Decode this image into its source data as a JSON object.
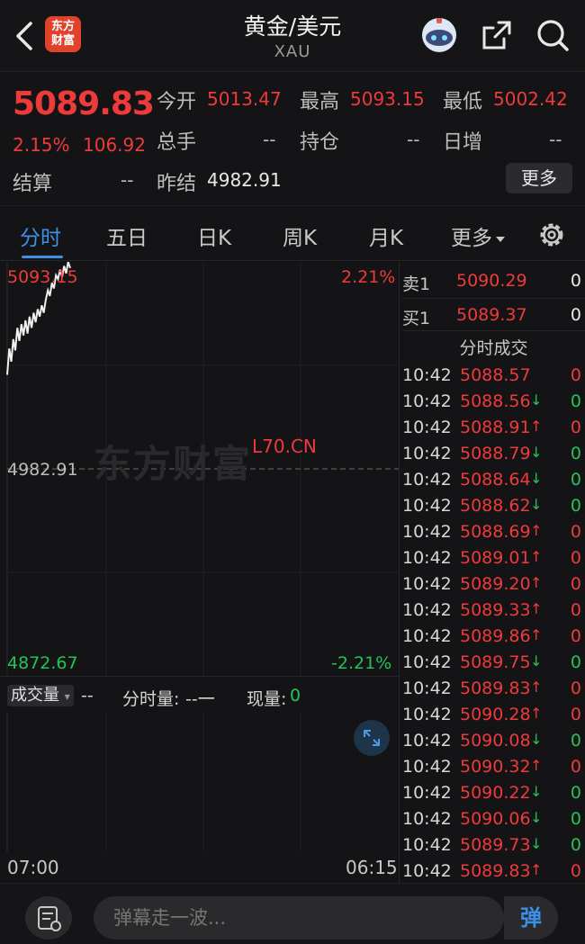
{
  "nav": {
    "logo_line1": "东方",
    "logo_line2": "财富",
    "title": "黄金/美元",
    "subtitle": "XAU"
  },
  "quote": {
    "last_price": "5089.83",
    "change_pct": "2.15%",
    "change_val": "106.92",
    "settle_label": "结算",
    "settle_val": "--",
    "open_label": "今开",
    "open_val": "5013.47",
    "high_label": "最高",
    "high_val": "5093.15",
    "low_label": "最低",
    "low_val": "5002.42",
    "volume_label": "总手",
    "volume_val": "--",
    "oi_label": "持仓",
    "oi_val": "--",
    "daily_inc_label": "日增",
    "daily_inc_val": "--",
    "prev_settle_label": "昨结",
    "prev_settle_val": "4982.91",
    "more_label": "更多"
  },
  "tabs": [
    {
      "label": "分时",
      "active": true
    },
    {
      "label": "五日",
      "active": false
    },
    {
      "label": "日K",
      "active": false
    },
    {
      "label": "周K",
      "active": false
    },
    {
      "label": "月K",
      "active": false
    },
    {
      "label": "更多",
      "active": false
    }
  ],
  "chart": {
    "top_price": "5093.15",
    "top_pct": "2.21%",
    "mid_price": "4982.91",
    "bottom_price": "4872.67",
    "bottom_pct": "-2.21%",
    "watermark": "东方财富",
    "overlay_text": "L70.CN",
    "time_start": "07:00",
    "time_end": "06:15"
  },
  "chart_data": {
    "type": "line",
    "y_range": [
      4872.67,
      5093.15
    ],
    "baseline": 4982.91,
    "series": [
      {
        "values": [
          5033,
          5047,
          5040,
          5052,
          5046,
          5058,
          5051,
          5060,
          5054,
          5062,
          5055,
          5064,
          5058,
          5066,
          5061,
          5068,
          5064,
          5070,
          5066,
          5073,
          5078,
          5075,
          5082,
          5079,
          5086,
          5084,
          5089,
          5085,
          5091,
          5087,
          5093.15,
          5089.83
        ]
      }
    ]
  },
  "volume": {
    "dropdown_label": "成交量",
    "vol_val": "--",
    "period_label": "分时量:",
    "period_val": "--一",
    "current_label": "现量:",
    "current_val": "0"
  },
  "orderbook": {
    "sell_label": "卖1",
    "sell_price": "5090.29",
    "sell_qty": "0",
    "buy_label": "买1",
    "buy_price": "5089.37",
    "buy_qty": "0",
    "ticks_title": "分时成交"
  },
  "ticks": [
    {
      "time": "10:42",
      "price": "5088.57",
      "dir": "",
      "vol": "0"
    },
    {
      "time": "10:42",
      "price": "5088.56",
      "dir": "down",
      "vol": "0"
    },
    {
      "time": "10:42",
      "price": "5088.91",
      "dir": "up",
      "vol": "0"
    },
    {
      "time": "10:42",
      "price": "5088.79",
      "dir": "down",
      "vol": "0"
    },
    {
      "time": "10:42",
      "price": "5088.64",
      "dir": "down",
      "vol": "0"
    },
    {
      "time": "10:42",
      "price": "5088.62",
      "dir": "down",
      "vol": "0"
    },
    {
      "time": "10:42",
      "price": "5088.69",
      "dir": "up",
      "vol": "0"
    },
    {
      "time": "10:42",
      "price": "5089.01",
      "dir": "up",
      "vol": "0"
    },
    {
      "time": "10:42",
      "price": "5089.20",
      "dir": "up",
      "vol": "0"
    },
    {
      "time": "10:42",
      "price": "5089.33",
      "dir": "up",
      "vol": "0"
    },
    {
      "time": "10:42",
      "price": "5089.86",
      "dir": "up",
      "vol": "0"
    },
    {
      "time": "10:42",
      "price": "5089.75",
      "dir": "down",
      "vol": "0"
    },
    {
      "time": "10:42",
      "price": "5089.83",
      "dir": "up",
      "vol": "0"
    },
    {
      "time": "10:42",
      "price": "5090.28",
      "dir": "up",
      "vol": "0"
    },
    {
      "time": "10:42",
      "price": "5090.08",
      "dir": "down",
      "vol": "0"
    },
    {
      "time": "10:42",
      "price": "5090.32",
      "dir": "up",
      "vol": "0"
    },
    {
      "time": "10:42",
      "price": "5090.22",
      "dir": "down",
      "vol": "0"
    },
    {
      "time": "10:42",
      "price": "5090.06",
      "dir": "down",
      "vol": "0"
    },
    {
      "time": "10:42",
      "price": "5089.73",
      "dir": "down",
      "vol": "0"
    },
    {
      "time": "10:42",
      "price": "5089.83",
      "dir": "up",
      "vol": "0"
    }
  ],
  "bottom": {
    "danmu_placeholder": "弹幕走一波...",
    "danmu_btn": "弹"
  },
  "colors": {
    "up": "#ef3a3a",
    "down": "#25c256",
    "accent": "#3d8fe8"
  }
}
